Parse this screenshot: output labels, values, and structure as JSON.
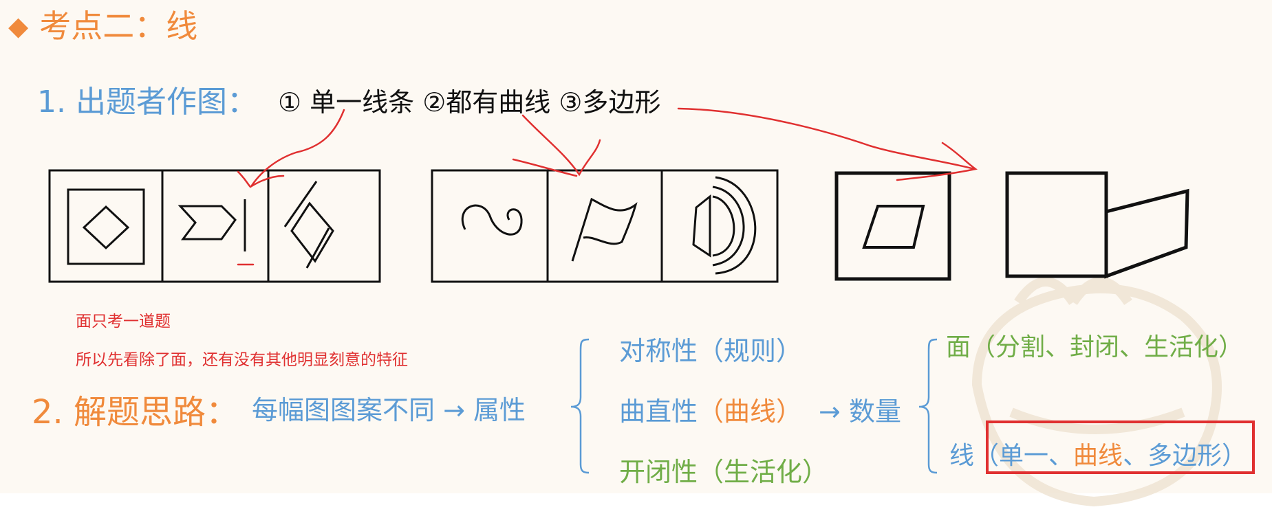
{
  "title": {
    "marker": "◆",
    "text": "考点二：线"
  },
  "q1": {
    "label": "1. 出题者作图：",
    "options": "① 单一线条 ②都有曲线 ③多边形"
  },
  "notes": {
    "note1": "面只考一道题",
    "note2": "所以先看除了面，还有没有其他明显刻意的特征"
  },
  "q2": {
    "label": "2. 解题思路：",
    "premise": "每幅图图案不同",
    "arrow1": "→",
    "attribute": "属性",
    "attrs": {
      "symmetry": {
        "name": "对称性",
        "detail": "（规则）"
      },
      "curvature": {
        "name": "曲直性",
        "detail": "（曲线）"
      },
      "closure": {
        "name": "开闭性",
        "detail": "（生活化）"
      }
    },
    "arrow2": "→",
    "quantity": "数量",
    "surface": {
      "name": "面",
      "detail": "（分割、封闭、生活化）"
    },
    "line": {
      "name": "线",
      "paren_open": "（",
      "single": "单一、",
      "curve": "曲线",
      "sep": "、",
      "polygon": "多边形",
      "paren_close": "）"
    }
  },
  "colors": {
    "title": "#f08a3c",
    "blue": "#5b9bd5",
    "orange": "#f08a3c",
    "green": "#70ad47",
    "annotation_red": "#e03030"
  }
}
